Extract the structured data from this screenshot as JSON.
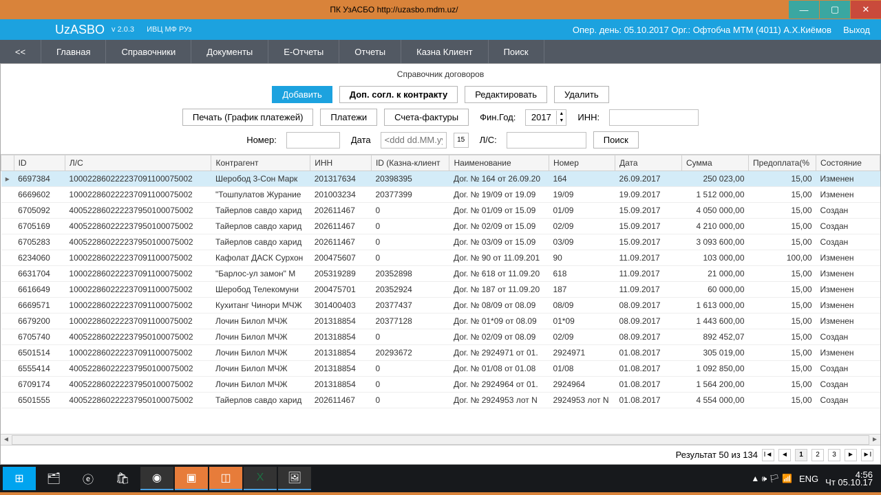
{
  "window": {
    "title": "ПК УзАСБО http://uzasbo.mdm.uz/"
  },
  "header": {
    "brand": "UzASBO",
    "version": "v 2.0.3",
    "ivc": "ИВЦ МФ РУз",
    "op_day": "Опер. день: 05.10.2017 Орг.: Офтобча МТМ (4011) А.Х.Киёмов",
    "exit": "Выход"
  },
  "nav": {
    "back": "<<",
    "items": [
      "Главная",
      "Справочники",
      "Документы",
      "Е-Отчеты",
      "Отчеты",
      "Казна Клиент",
      "Поиск"
    ]
  },
  "page": {
    "title": "Справочник договоров"
  },
  "toolbar1": {
    "add": "Добавить",
    "addl": "Доп. согл. к контракту",
    "edit": "Редактировать",
    "del": "Удалить"
  },
  "toolbar2": {
    "print": "Печать (График платежей)",
    "payments": "Платежи",
    "invoices": "Счета-фактуры",
    "fin_year_lbl": "Фин.Год:",
    "fin_year": "2017",
    "inn_lbl": "ИНН:",
    "inn": ""
  },
  "toolbar3": {
    "no_lbl": "Номер:",
    "no": "",
    "date_lbl": "Дата",
    "date_ph": "<ddd dd.MM.yy>",
    "ls_lbl": "Л/С:",
    "ls": "",
    "search": "Поиск"
  },
  "columns": [
    "ID",
    "Л/С",
    "Контрагент",
    "ИНН",
    "ID (Казна-клиент",
    "Наименование",
    "Номер",
    "Дата",
    "Сумма",
    "Предоплата(%",
    "Состояние"
  ],
  "rows": [
    {
      "sel": true,
      "id": "6697384",
      "ls": "100022860222237091100075002",
      "ka": "Шеробод 3-Сон Марк",
      "inn": "201317634",
      "kk": "20398395",
      "nm": "Дог. № 164 от 26.09.20",
      "no": "164",
      "dt": "26.09.2017",
      "sum": "250 023,00",
      "pp": "15,00",
      "st": "Изменен"
    },
    {
      "id": "6669602",
      "ls": "100022860222237091100075002",
      "ka": "\"Тошпулатов Журание",
      "inn": "201003234",
      "kk": "20377399",
      "nm": "Дог. № 19/09 от 19.09",
      "no": "19/09",
      "dt": "19.09.2017",
      "sum": "1 512 000,00",
      "pp": "15,00",
      "st": "Изменен"
    },
    {
      "id": "6705092",
      "ls": "400522860222237950100075002",
      "ka": "Тайерлов савдо харид",
      "inn": "202611467",
      "kk": "0",
      "nm": "Дог. № 01/09 от 15.09",
      "no": "01/09",
      "dt": "15.09.2017",
      "sum": "4 050 000,00",
      "pp": "15,00",
      "st": "Создан"
    },
    {
      "id": "6705169",
      "ls": "400522860222237950100075002",
      "ka": "Тайерлов савдо харид",
      "inn": "202611467",
      "kk": "0",
      "nm": "Дог. № 02/09 от 15.09",
      "no": "02/09",
      "dt": "15.09.2017",
      "sum": "4 210 000,00",
      "pp": "15,00",
      "st": "Создан"
    },
    {
      "id": "6705283",
      "ls": "400522860222237950100075002",
      "ka": "Тайерлов савдо харид",
      "inn": "202611467",
      "kk": "0",
      "nm": "Дог. № 03/09 от 15.09",
      "no": "03/09",
      "dt": "15.09.2017",
      "sum": "3 093 600,00",
      "pp": "15,00",
      "st": "Создан"
    },
    {
      "id": "6234060",
      "ls": "100022860222237091100075002",
      "ka": "Кафолат ДАСК Сурхон",
      "inn": "200475607",
      "kk": "0",
      "nm": "Дог. № 90 от 11.09.201",
      "no": "90",
      "dt": "11.09.2017",
      "sum": "103 000,00",
      "pp": "100,00",
      "st": "Изменен"
    },
    {
      "id": "6631704",
      "ls": "100022860222237091100075002",
      "ka": "\"Барлос-ул замон\" М",
      "inn": "205319289",
      "kk": "20352898",
      "nm": "Дог. № 618 от 11.09.20",
      "no": "618",
      "dt": "11.09.2017",
      "sum": "21 000,00",
      "pp": "15,00",
      "st": "Изменен"
    },
    {
      "id": "6616649",
      "ls": "100022860222237091100075002",
      "ka": "Шеробод Телекомуни",
      "inn": "200475701",
      "kk": "20352924",
      "nm": "Дог. № 187 от 11.09.20",
      "no": "187",
      "dt": "11.09.2017",
      "sum": "60 000,00",
      "pp": "15,00",
      "st": "Изменен"
    },
    {
      "id": "6669571",
      "ls": "100022860222237091100075002",
      "ka": "Кухитанг Чинори МЧЖ",
      "inn": "301400403",
      "kk": "20377437",
      "nm": "Дог. № 08/09 от 08.09",
      "no": "08/09",
      "dt": "08.09.2017",
      "sum": "1 613 000,00",
      "pp": "15,00",
      "st": "Изменен"
    },
    {
      "id": "6679200",
      "ls": "100022860222237091100075002",
      "ka": "Лочин Билол МЧЖ",
      "inn": "201318854",
      "kk": "20377128",
      "nm": "Дог. № 01*09 от 08.09",
      "no": "01*09",
      "dt": "08.09.2017",
      "sum": "1 443 600,00",
      "pp": "15,00",
      "st": "Изменен"
    },
    {
      "id": "6705740",
      "ls": "400522860222237950100075002",
      "ka": "Лочин Билол МЧЖ",
      "inn": "201318854",
      "kk": "0",
      "nm": "Дог. № 02/09 от 08.09",
      "no": "02/09",
      "dt": "08.09.2017",
      "sum": "892 452,07",
      "pp": "15,00",
      "st": "Создан"
    },
    {
      "id": "6501514",
      "ls": "100022860222237091100075002",
      "ka": "Лочин Билол МЧЖ",
      "inn": "201318854",
      "kk": "20293672",
      "nm": "Дог. № 2924971 от 01.",
      "no": "2924971",
      "dt": "01.08.2017",
      "sum": "305 019,00",
      "pp": "15,00",
      "st": "Изменен"
    },
    {
      "id": "6555414",
      "ls": "400522860222237950100075002",
      "ka": "Лочин Билол МЧЖ",
      "inn": "201318854",
      "kk": "0",
      "nm": "Дог. № 01/08 от 01.08",
      "no": "01/08",
      "dt": "01.08.2017",
      "sum": "1 092 850,00",
      "pp": "15,00",
      "st": "Создан"
    },
    {
      "id": "6709174",
      "ls": "400522860222237950100075002",
      "ka": "Лочин Билол МЧЖ",
      "inn": "201318854",
      "kk": "0",
      "nm": "Дог. № 2924964 от 01.",
      "no": "2924964",
      "dt": "01.08.2017",
      "sum": "1 564 200,00",
      "pp": "15,00",
      "st": "Создан"
    },
    {
      "id": "6501555",
      "ls": "400522860222237950100075002",
      "ka": "Тайерлов савдо харид",
      "inn": "202611467",
      "kk": "0",
      "nm": "Дог. № 2924953  лот N",
      "no": "2924953  лот N",
      "dt": "01.08.2017",
      "sum": "4 554 000,00",
      "pp": "15,00",
      "st": "Создан"
    }
  ],
  "pager": {
    "result": "Результат  50  из  134",
    "pages": [
      "1",
      "2",
      "3"
    ]
  },
  "tray": {
    "lang": "ENG",
    "time": "4:56",
    "date": "Чт 05.10.17"
  }
}
